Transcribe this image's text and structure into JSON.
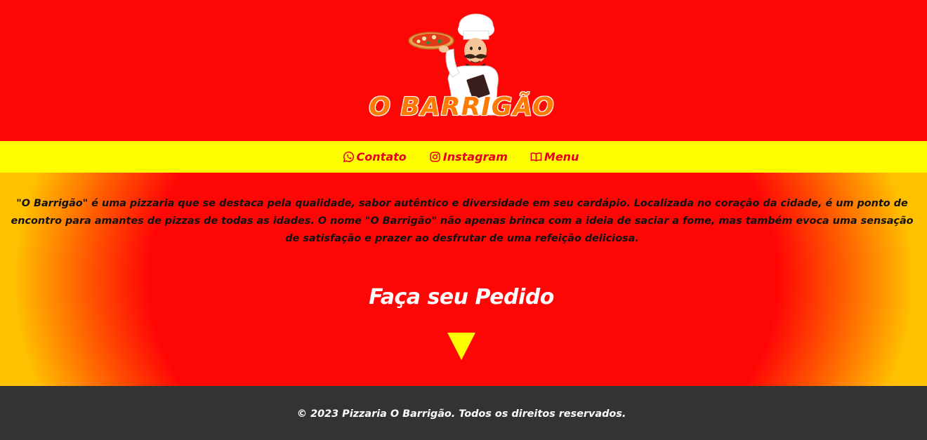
{
  "header": {
    "logo_text": "O BARRIGÃO"
  },
  "nav": {
    "items": [
      {
        "label": "Contato",
        "icon": "whatsapp-icon"
      },
      {
        "label": "Instagram",
        "icon": "instagram-icon"
      },
      {
        "label": "Menu",
        "icon": "book-open-icon"
      }
    ]
  },
  "main": {
    "intro": "\"O Barrigão\" é uma pizzaria que se destaca pela qualidade, sabor autêntico e diversidade em seu cardápio. Localizada no coração da cidade, é um ponto de encontro para amantes de pizzas de todas as idades. O nome \"O Barrigão\" não apenas brinca com a ideia de saciar a fome, mas também evoca uma sensação de satisfação e prazer ao desfrutar de uma refeição deliciosa.",
    "order_title": "Faça seu Pedido",
    "arrow_icon": "triangle-down-icon"
  },
  "footer": {
    "copyright": "© 2023 Pizzaria O Barrigão. Todos os direitos reservados."
  },
  "colors": {
    "header_bg": "#ff0606",
    "nav_bg": "#ffff00",
    "nav_text": "#e8001a",
    "footer_bg": "#333333",
    "accent_yellow": "#ffff00",
    "logo_orange": "#ff7a00"
  }
}
